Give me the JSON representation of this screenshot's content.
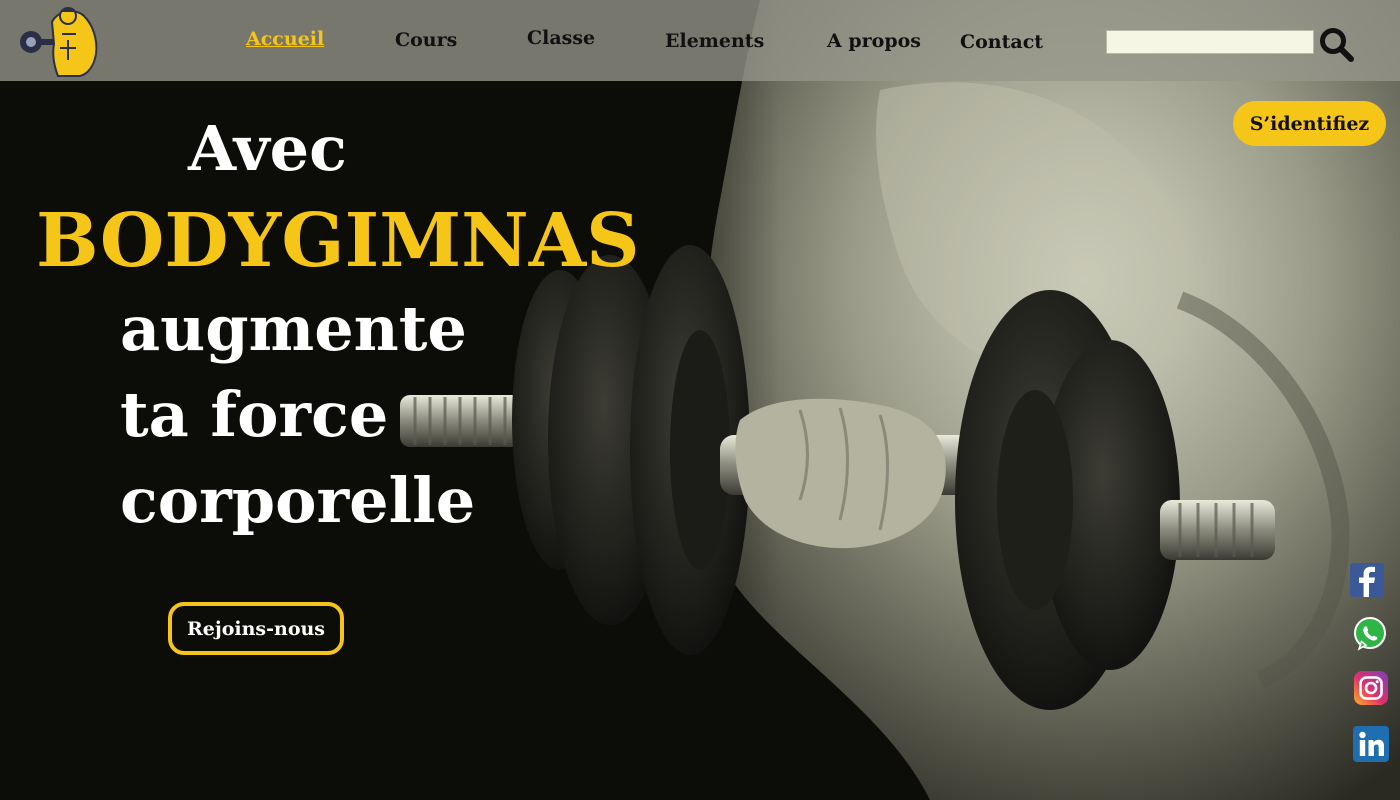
{
  "nav": {
    "items": [
      {
        "label": "Accueil",
        "active": true
      },
      {
        "label": "Cours"
      },
      {
        "label": "Classe"
      },
      {
        "label": "Elements"
      },
      {
        "label": "A propos"
      },
      {
        "label": "Contact"
      }
    ],
    "search_placeholder": "",
    "search_value": ""
  },
  "hero": {
    "line1": "Avec",
    "brand": "BODYGIMNAS",
    "line3": "augmente",
    "line4": "ta force",
    "line5": "corporelle",
    "cta_label": "Rejoins-nous"
  },
  "login_label": "S’identifiez",
  "social": [
    "facebook-icon",
    "whatsapp-icon",
    "instagram-icon",
    "linkedin-icon"
  ],
  "colors": {
    "accent": "#f5c518",
    "header_bg": "#96968a",
    "hero_bg": "#0c0c08",
    "text_light": "#ffffff"
  }
}
